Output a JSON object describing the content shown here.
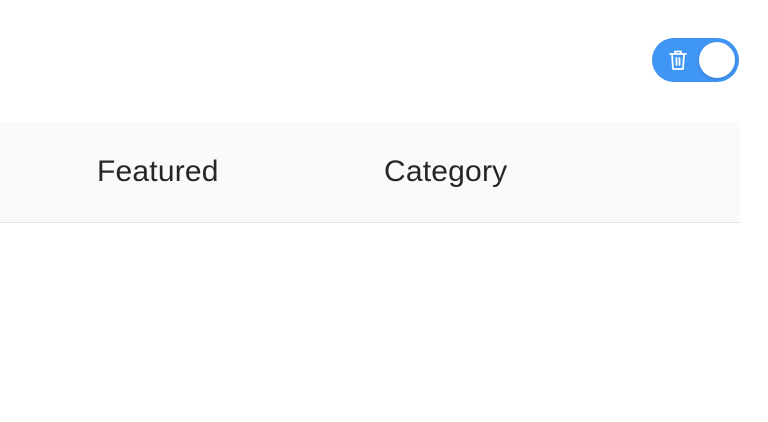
{
  "toggle": {
    "icon": "trash-icon",
    "checked": true,
    "on_color": "#4096f5"
  },
  "table": {
    "columns": [
      {
        "label": "Featured"
      },
      {
        "label": "Category"
      }
    ],
    "header_background": "#fafafa"
  }
}
